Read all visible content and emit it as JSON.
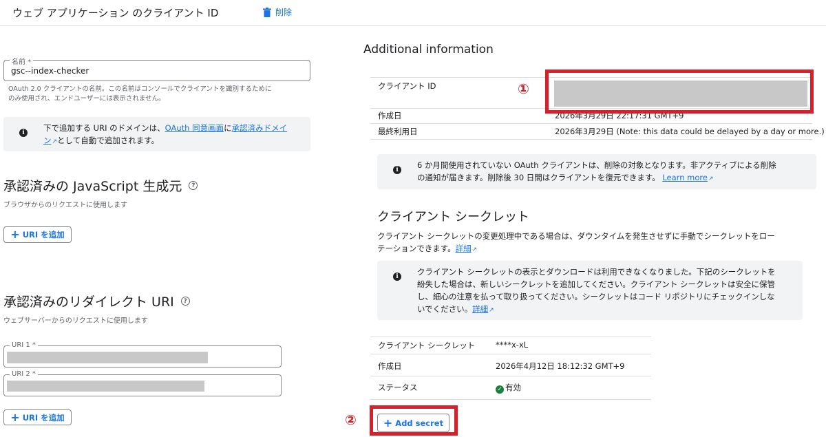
{
  "header": {
    "title": "ウェブ アプリケーション のクライアント ID",
    "delete_label": "削除"
  },
  "name_field": {
    "label": "名前 *",
    "value": "gsc--index-checker",
    "helper_line1": "OAuth 2.0 クライアントの名前。この名前はコンソールでクライアントを識別するために",
    "helper_line2": "のみ使用され、エンドユーザーには表示されません。"
  },
  "domain_notice": {
    "pre": "下で追加する URI のドメインは、",
    "link1": "OAuth 同意画面",
    "mid": "に",
    "link2a": "承認済みドメイ",
    "link2b": "ン",
    "post": "として自動で追加されます。"
  },
  "js_origins": {
    "title": "承認済みの JavaScript 生成元",
    "subtitle": "ブラウザからのリクエストに使用します",
    "add_label": "URI を追加"
  },
  "redirect_uris": {
    "title": "承認済みのリダイレクト URI",
    "subtitle": "ウェブサーバーからのリクエストに使用します",
    "uri1_label": "URI 1 *",
    "uri2_label": "URI 2 *",
    "add_label": "URI を追加"
  },
  "additional_info": {
    "title": "Additional information",
    "client_id_label": "クライアント ID",
    "created_label": "作成日",
    "created_value": "2026年3月29日 22:17:31 GMT+9",
    "last_used_label": "最終利用日",
    "last_used_value": "2026年3月29日 (Note: this data could be delayed by a day or more.)",
    "inactive_notice_line1": "6 か月間使用されていない OAuth クライアントは、削除の対象となります。非アクティブによる削除",
    "inactive_notice_line2": "の通知が届きます。削除後 30 日間はクライアントを復元できます。",
    "learn_more": "Learn more"
  },
  "client_secret": {
    "title": "クライアント シークレット",
    "desc_line1": "クライアント シークレットの変更処理中である場合は、ダウンタイムを発生させずに手動でシークレットをロー",
    "desc_line2": "テーションできます。",
    "details_link": "詳細",
    "notice_line1": "クライアント シークレットの表示とダウンロードは利用できなくなりました。下記のシークレットを",
    "notice_line2": "紛失した場合は、新しいシークレットを追加してください。クライアント シークレットは安全に保管",
    "notice_line3": "し、細心の注意を払って取り扱ってください。シークレットはコード リポジトリにチェックインしな",
    "notice_line4": "いでください。",
    "notice_details_link": "詳細",
    "secret_label": "クライアント シークレット",
    "secret_value": "****x-xL",
    "created_label": "作成日",
    "created_value": "2026年4月12日 18:12:32 GMT+9",
    "status_label": "ステータス",
    "status_value": "有効",
    "add_secret_label": "Add secret"
  },
  "annotations": {
    "marker1": "①",
    "marker2": "②"
  },
  "colors": {
    "accent": "#1a73e8",
    "annotation_red": "#d6202a",
    "status_green": "#188038"
  }
}
